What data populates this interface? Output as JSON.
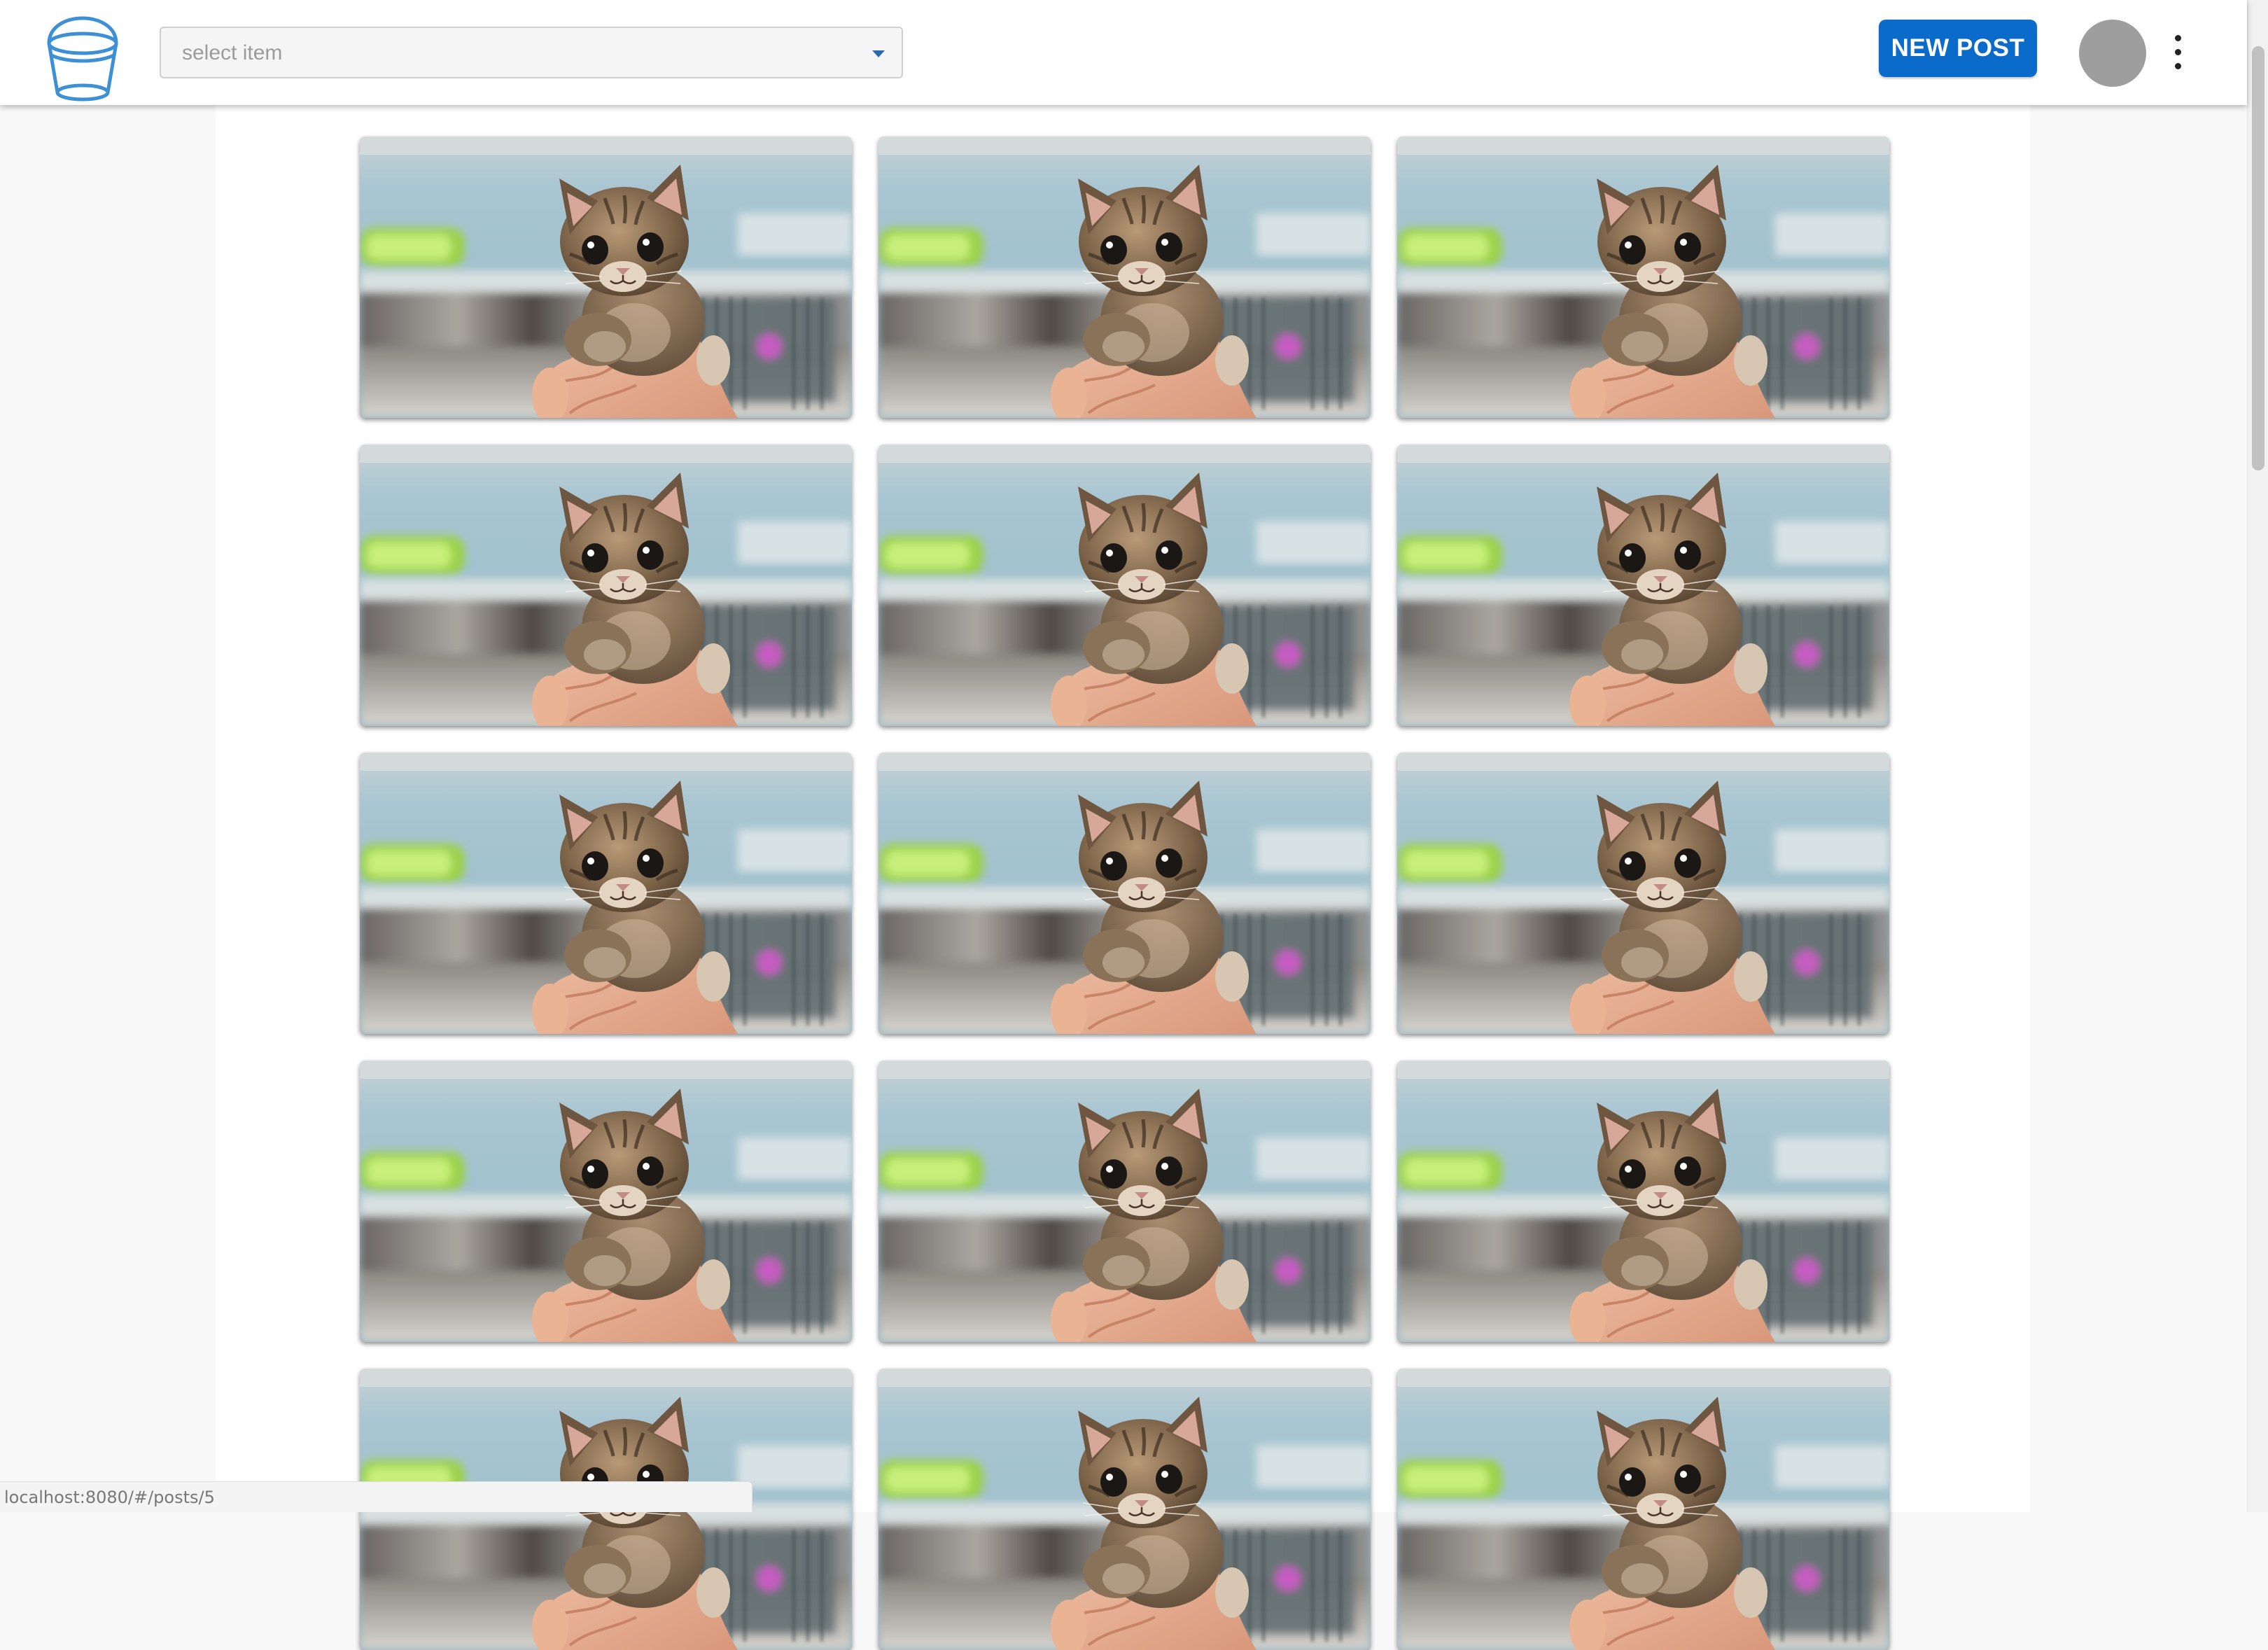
{
  "header": {
    "logo_icon": "bucket-logo-icon",
    "select": {
      "placeholder": "select item",
      "arrow_icon": "caret-down-icon"
    },
    "new_post_label": "NEW POST",
    "avatar_icon": "user-avatar",
    "menu_icon": "more-vert-icon"
  },
  "colors": {
    "accent": "#0b6bcb",
    "logo": "#3d8fd6",
    "avatar": "#9e9e9e",
    "background": "#f8f8f8"
  },
  "gallery": {
    "image_subject": "kitten-photo",
    "columns": 3,
    "posts": [
      {
        "id": 1
      },
      {
        "id": 2
      },
      {
        "id": 3
      },
      {
        "id": 4
      },
      {
        "id": 5
      },
      {
        "id": 6
      },
      {
        "id": 7
      },
      {
        "id": 8
      },
      {
        "id": 9
      },
      {
        "id": 10
      },
      {
        "id": 11
      },
      {
        "id": 12
      },
      {
        "id": 13
      },
      {
        "id": 14
      },
      {
        "id": 15
      }
    ]
  },
  "status_bar": {
    "url": "localhost:8080/#/posts/5"
  }
}
